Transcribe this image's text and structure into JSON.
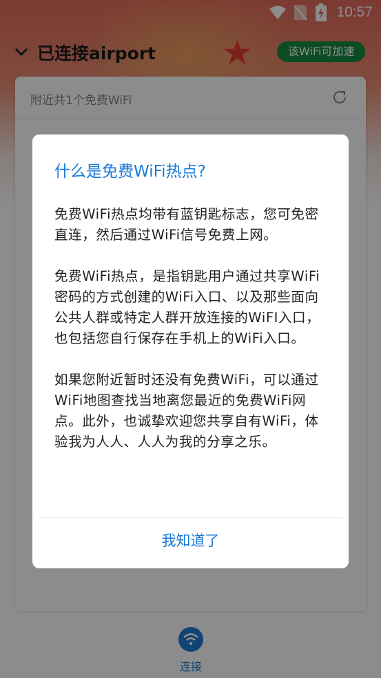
{
  "statusbar": {
    "time": "10:57"
  },
  "header": {
    "title": "已连接airport",
    "speed_badge": "该WiFi可加速"
  },
  "card": {
    "header_text": "附近共1个免费WiFi"
  },
  "bottom_nav": {
    "label": "连接"
  },
  "dialog": {
    "title": "什么是免费WiFi热点?",
    "paragraphs": [
      "免费WiFi热点均带有蓝钥匙标志，您可免密直连，然后通过WiFi信号免费上网。",
      "免费WiFi热点，是指钥匙用户通过共享WiFi密码的方式创建的WiFi入口、以及那些面向公共人群或特定人群开放连接的WiFI入口，也包括您自行保存在手机上的WiFi入口。",
      "如果您附近暂时还没有免费WiFi，可以通过WiFi地图查找当地离您最近的免费WiFi网点。此外，也诚挚欢迎您共享自有WiFi，体验我为人人、人人为我的分享之乐。"
    ],
    "confirm_label": "我知道了"
  },
  "colors": {
    "accent": "#1a7ad8",
    "badge": "#178a3e"
  },
  "icons": [
    "wifi-signal-icon",
    "no-sim-icon",
    "battery-charging-icon",
    "chevron-down-icon",
    "refresh-icon",
    "wifi-icon"
  ]
}
